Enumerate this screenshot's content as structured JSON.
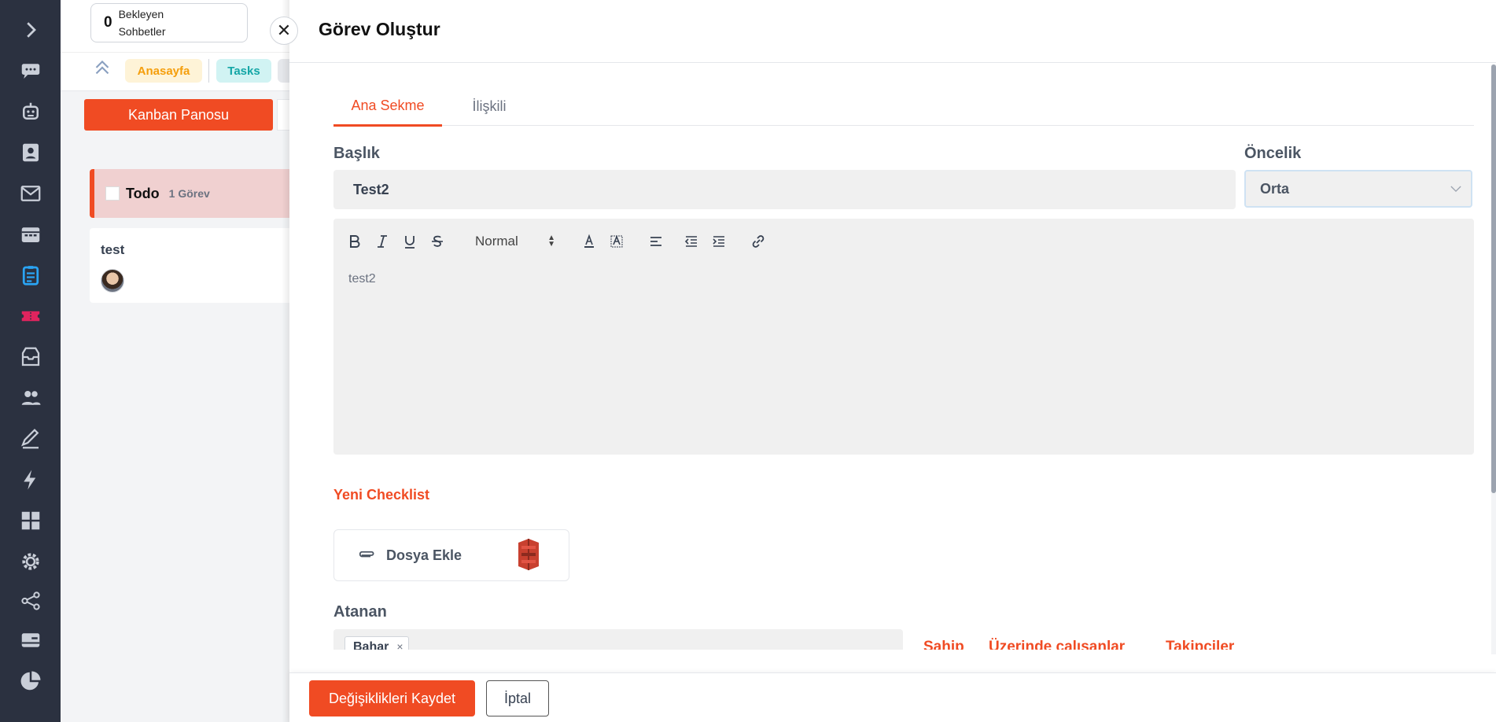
{
  "sidebar": {
    "icons": [
      "chevron-right-icon",
      "chat-icon",
      "bot-icon",
      "contact-card-icon",
      "mail-icon",
      "calendar-icon",
      "tasks-icon",
      "ticket-icon",
      "inbox-icon",
      "users-icon",
      "edit-icon",
      "lightning-icon",
      "dashboard-icon",
      "settings-icon",
      "share-icon",
      "card-icon",
      "pie-chart-icon"
    ],
    "active_icon": "tasks-icon",
    "colors": {
      "bg": "#2b3140",
      "icon": "#c9ced8",
      "active": "#2aa4f4",
      "ticket": "#e0245e"
    }
  },
  "background": {
    "pending": {
      "count": "0",
      "label": "Bekleyen Sohbetler"
    },
    "tabs": {
      "home": "Anasayfa",
      "tasks": "Tasks"
    },
    "kanban_button": "Kanban Panosu",
    "column": {
      "title": "Todo",
      "count": "1 Görev"
    },
    "card": {
      "title": "test"
    }
  },
  "drawer": {
    "title": "Görev Oluştur",
    "tabs": {
      "main": "Ana Sekme",
      "related": "İlişkili"
    },
    "title_label": "Başlık",
    "title_value": "Test2",
    "priority_label": "Öncelik",
    "priority_value": "Orta",
    "editor": {
      "format": "Normal",
      "body": "test2"
    },
    "new_checklist": "Yeni Checklist",
    "attach_label": "Dosya Ekle",
    "assignee_label": "Atanan",
    "assignee_chip": "Bahar",
    "assignee_remove": "×",
    "roles": {
      "owner": "Sahip",
      "working": "Üzerinde çalışanlar",
      "followers": "Takipçiler"
    },
    "save_button": "Değişiklikleri Kaydet",
    "cancel_button": "İptal",
    "close_glyph": "✕"
  },
  "colors": {
    "accent": "#f04b23",
    "input_bg": "#f0f0f0"
  }
}
